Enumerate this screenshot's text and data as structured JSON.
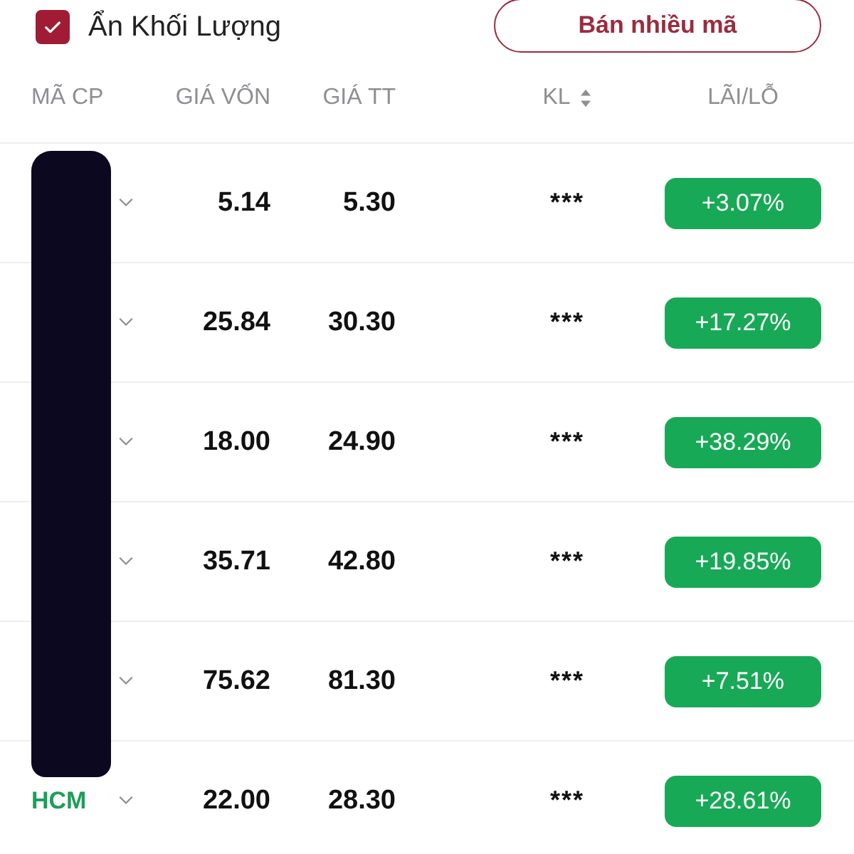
{
  "hide_volume": {
    "label": "Ẩn Khối Lượng",
    "checked": true
  },
  "sell_button": {
    "label": "Bán nhiều mã"
  },
  "table": {
    "columns": [
      {
        "label": "MÃ CP"
      },
      {
        "label": "GIÁ VỐN"
      },
      {
        "label": "GIÁ TT"
      },
      {
        "label": "KL",
        "sortable": true
      },
      {
        "label": "LÃI/LỖ"
      }
    ],
    "rows": [
      {
        "cost": "5.14",
        "price": "5.30",
        "volume": "***",
        "pnl": "+3.07%"
      },
      {
        "cost": "25.84",
        "price": "30.30",
        "volume": "***",
        "pnl": "+17.27%"
      },
      {
        "cost": "18.00",
        "price": "24.90",
        "volume": "***",
        "pnl": "+38.29%"
      },
      {
        "cost": "35.71",
        "price": "42.80",
        "volume": "***",
        "pnl": "+19.85%"
      },
      {
        "cost": "75.62",
        "price": "81.30",
        "volume": "***",
        "pnl": "+7.51%"
      },
      {
        "code": "HCM",
        "cost": "22.00",
        "price": "28.30",
        "volume": "***",
        "pnl": "+28.61%"
      }
    ]
  }
}
